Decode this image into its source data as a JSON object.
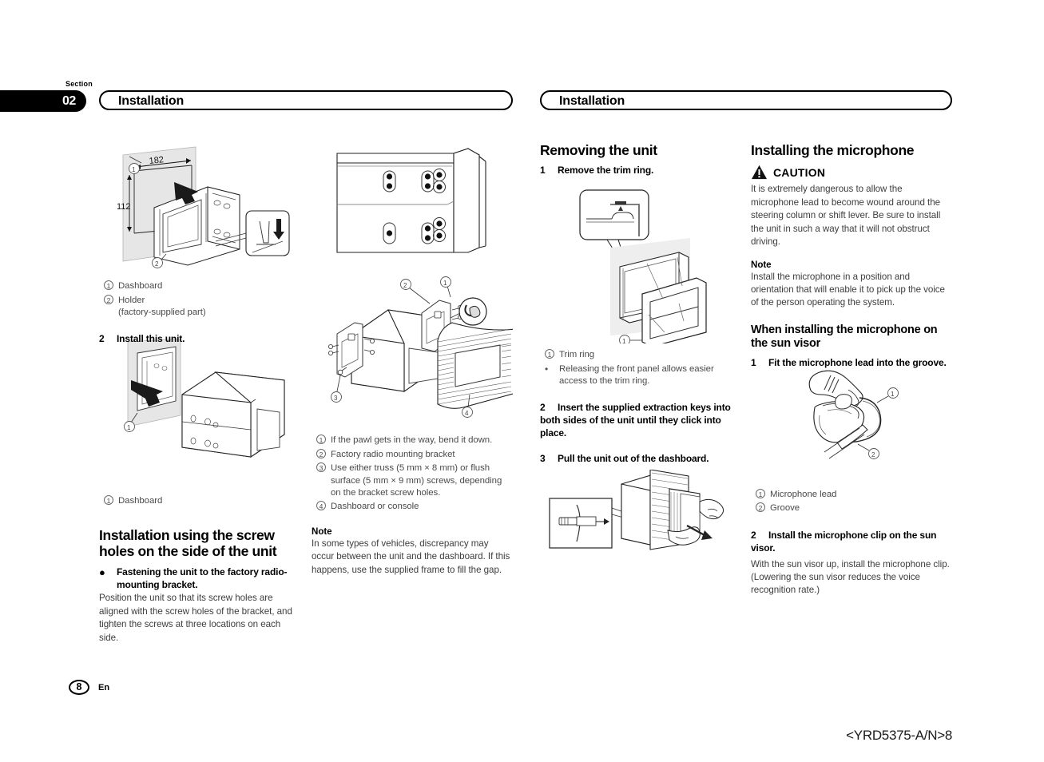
{
  "section": {
    "label": "Section",
    "number": "02"
  },
  "headers": {
    "left": "Installation",
    "right": "Installation"
  },
  "column1": {
    "fig1": {
      "name": "dashboard-holder-exploded",
      "dim_width": "182",
      "dim_height": "112",
      "callout_1": "1",
      "callout_2": "2"
    },
    "keys_fig1": [
      {
        "mark": "1",
        "text": "Dashboard"
      },
      {
        "mark": "2",
        "text": "Holder",
        "sub": "(factory-supplied part)"
      }
    ],
    "step2": {
      "num": "2",
      "text": "Install this unit."
    },
    "fig2": {
      "name": "install-unit-dashboard",
      "callout_1": "1"
    },
    "keys_fig2": [
      {
        "mark": "1",
        "text": "Dashboard"
      }
    ],
    "heading": "Installation using the screw holes on the side of the unit",
    "bullet": "Fastening the unit to the factory radio-mounting bracket.",
    "paragraph": "Position the unit so that its screw holes are aligned with the screw holes of the bracket, and tighten the screws at three locations on each side."
  },
  "column2": {
    "fig3": {
      "name": "factory-bracket-screw-holes"
    },
    "fig4": {
      "name": "bracket-mounting-exploded",
      "callout_1": "1",
      "callout_2": "2",
      "callout_3": "3",
      "callout_4": "4"
    },
    "keys_fig4": [
      {
        "mark": "1",
        "text": "If the pawl gets in the way, bend it down."
      },
      {
        "mark": "2",
        "text": "Factory radio mounting bracket"
      },
      {
        "mark": "3",
        "text": "Use either truss (5 mm × 8 mm) or flush surface (5 mm × 9 mm) screws, depending on the bracket screw holes."
      },
      {
        "mark": "4",
        "text": "Dashboard or console"
      }
    ],
    "note_head": "Note",
    "note_text": "In some types of vehicles, discrepancy may occur between the unit and the dashboard. If this happens, use the supplied frame to fill the gap."
  },
  "column3": {
    "heading": "Removing the unit",
    "step1": {
      "num": "1",
      "text": "Remove the trim ring."
    },
    "fig5": {
      "name": "trim-ring-removal",
      "callout_1": "1"
    },
    "keys_fig5": [
      {
        "mark": "1",
        "text": "Trim ring"
      },
      {
        "mark": "bullet",
        "text": "Releasing the front panel allows easier access to the trim ring."
      }
    ],
    "step2": {
      "num": "2",
      "text": "Insert the supplied extraction keys into both sides of the unit until they click into place."
    },
    "step3": {
      "num": "3",
      "text": "Pull the unit out of the dashboard."
    },
    "fig6": {
      "name": "pull-unit-out-dashboard"
    }
  },
  "column4": {
    "heading": "Installing the microphone",
    "caution_word": "CAUTION",
    "caution_text": "It is extremely dangerous to allow the microphone lead to become wound around the steering column or shift lever. Be sure to install the unit in such a way that it will not obstruct driving.",
    "note_head": "Note",
    "note_text": "Install the microphone in a position and orientation that will enable it to pick up the voice of the person operating the system.",
    "subheading": "When installing the microphone on the sun visor",
    "step1": {
      "num": "1",
      "text": "Fit the microphone lead into the groove."
    },
    "fig7": {
      "name": "microphone-clip-sun-visor",
      "callout_1": "1",
      "callout_2": "2"
    },
    "keys_fig7": [
      {
        "mark": "1",
        "text": "Microphone lead"
      },
      {
        "mark": "2",
        "text": "Groove"
      }
    ],
    "step2": {
      "num": "2",
      "text": "Install the microphone clip on the sun visor."
    },
    "paragraph": "With the sun visor up, install the microphone clip. (Lowering the sun visor reduces the voice recognition rate.)"
  },
  "footer": {
    "page_number": "8",
    "language": "En",
    "part_code": "<YRD5375-A/N>8"
  }
}
